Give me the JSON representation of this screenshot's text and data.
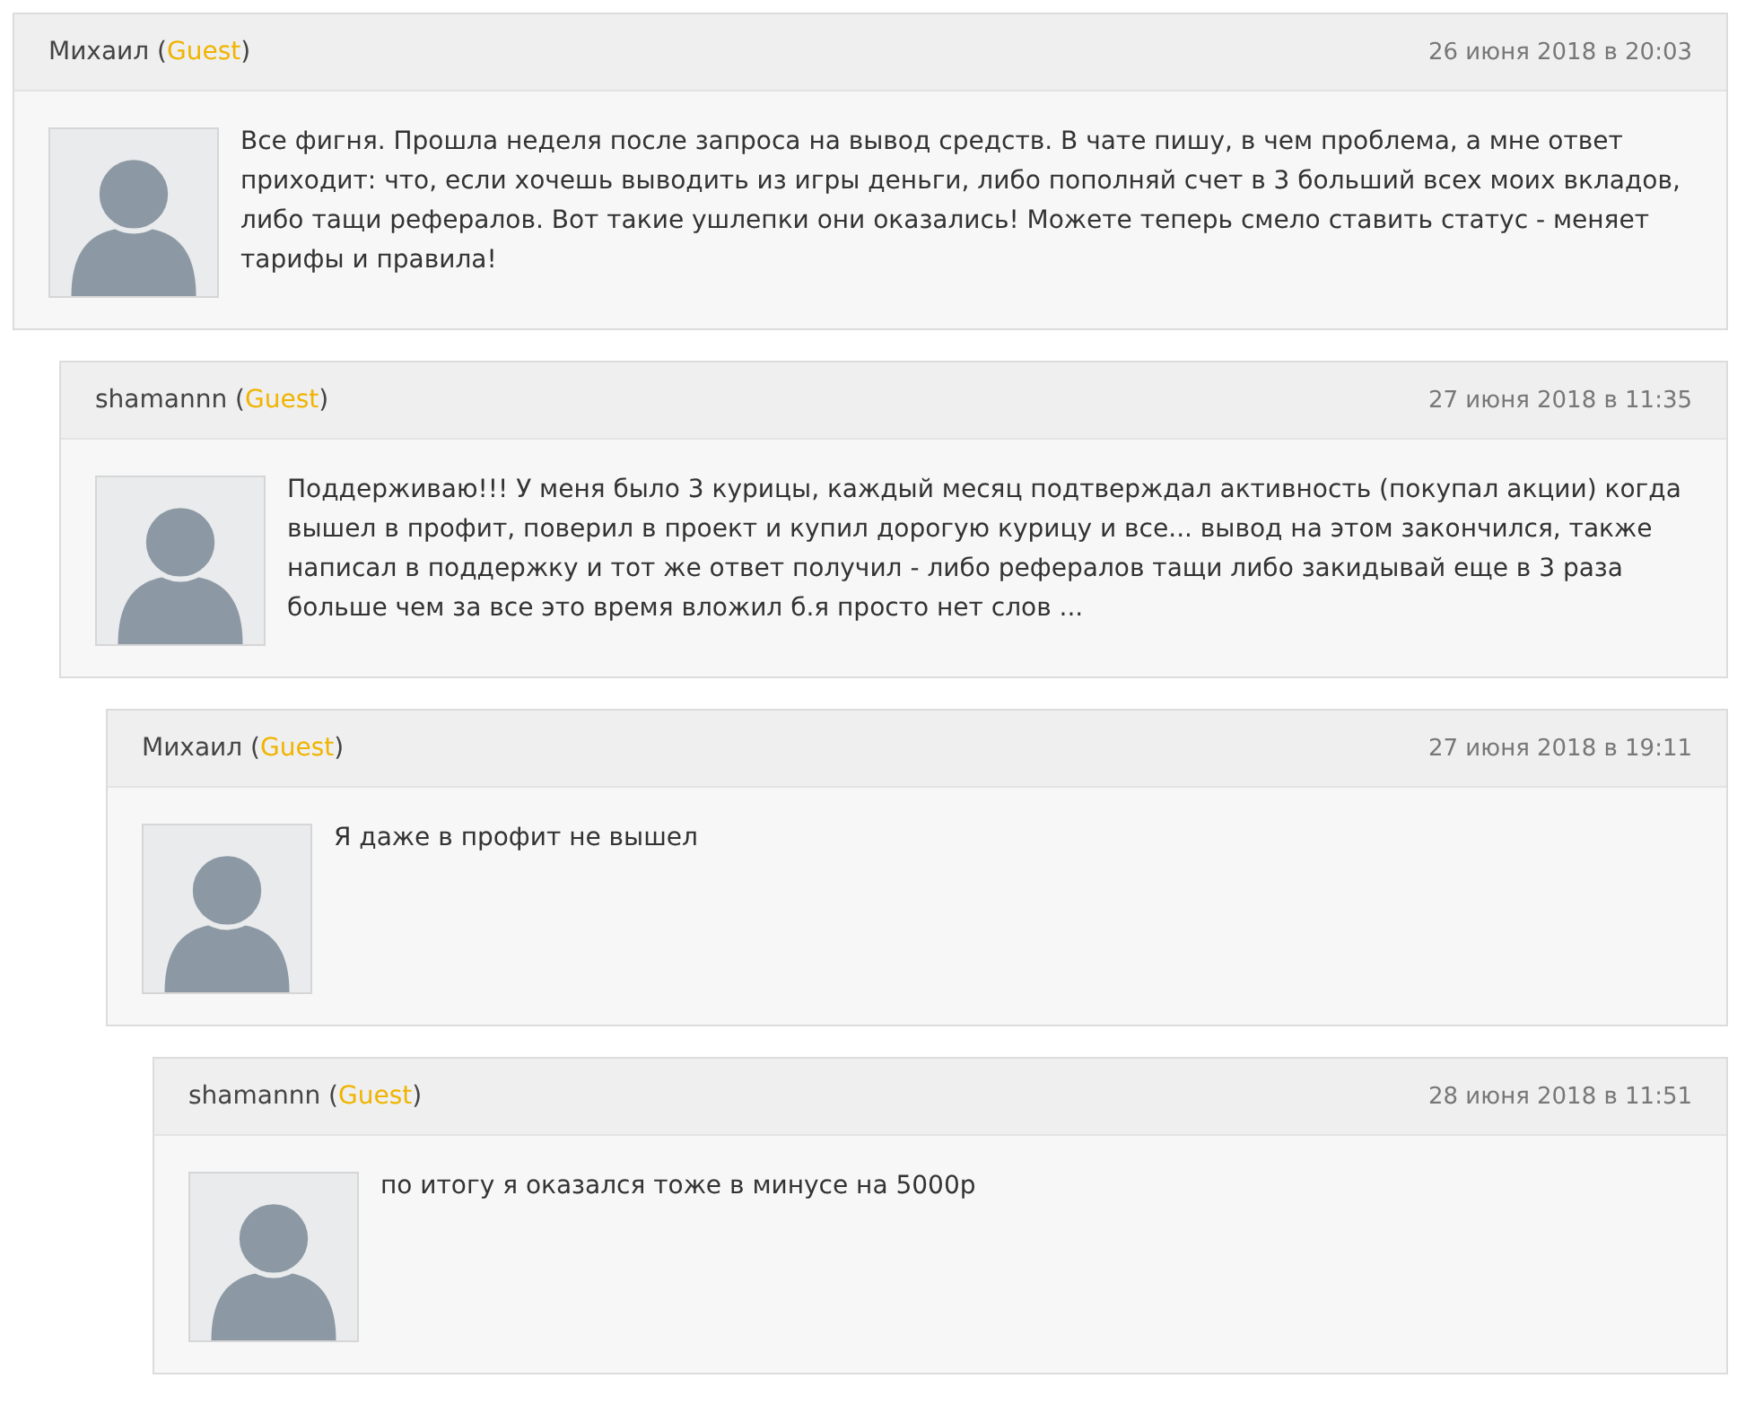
{
  "comments": [
    {
      "author": "Михаил",
      "paren_open": "(",
      "role": "Guest",
      "paren_close": ")",
      "date": "26 июня 2018 в 20:03",
      "text": "Все фигня. Прошла неделя после запроса на вывод средств. В чате пишу, в чем проблема, а мне ответ приходит: что, если хочешь выводить из игры деньги, либо пополняй счет в 3 больший всех моих вкладов, либо тащи рефералов. Вот такие ушлепки они оказались! Можете теперь смело ставить статус - меняет тарифы и правила!",
      "children": [
        {
          "author": "shamannn",
          "paren_open": "(",
          "role": "Guest",
          "paren_close": ")",
          "date": "27 июня 2018 в 11:35",
          "text": "Поддерживаю!!! У меня было 3 курицы, каждый месяц подтверждал активность (покупал акции) когда вышел в профит, поверил в проект и купил дорогую курицу и все... вывод на этом закончился, также написал в поддержку и тот же ответ получил - либо рефералов тащи либо закидывай еще в 3 раза больше чем за все это время вложил б.я просто нет слов ...",
          "children": [
            {
              "author": "Михаил",
              "paren_open": "(",
              "role": "Guest",
              "paren_close": ")",
              "date": "27 июня 2018 в 19:11",
              "text": "Я даже в профит не вышел",
              "children": [
                {
                  "author": "shamannn",
                  "paren_open": "(",
                  "role": "Guest",
                  "paren_close": ")",
                  "date": "28 июня 2018 в 11:51",
                  "text": "по итогу я оказался тоже в минусе на 5000р"
                }
              ]
            }
          ]
        }
      ]
    }
  ]
}
